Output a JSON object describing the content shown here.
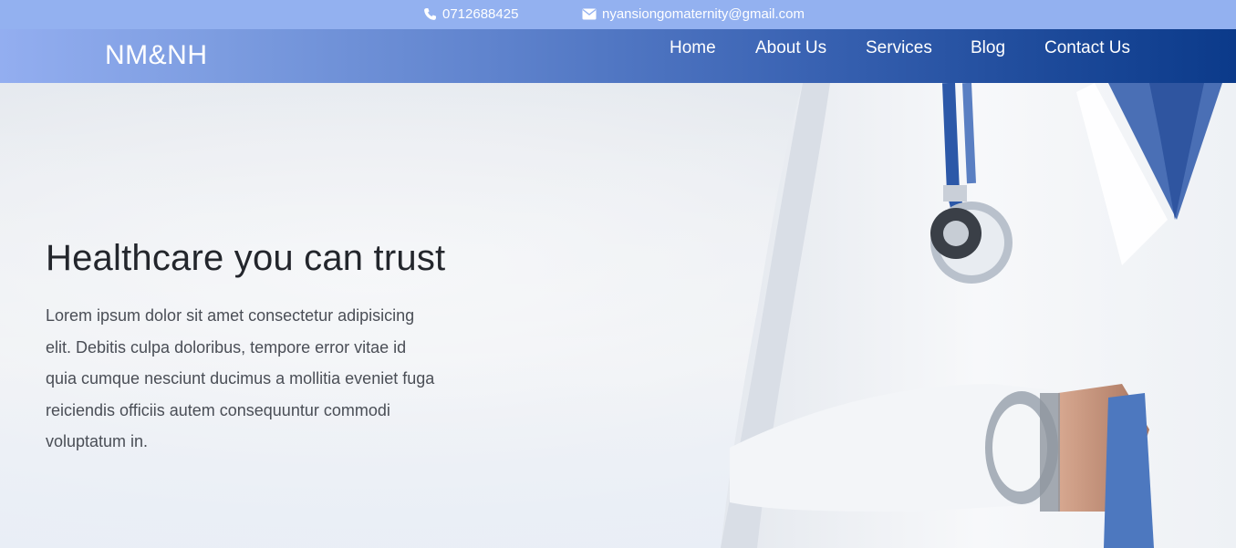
{
  "topbar": {
    "phone": "0712688425",
    "email": "nyansiongomaternity@gmail.com",
    "phone_icon": "phone-icon",
    "email_icon": "envelope-icon"
  },
  "navbar": {
    "brand": "NM&NH",
    "links": [
      {
        "label": "Home"
      },
      {
        "label": "About Us"
      },
      {
        "label": "Services"
      },
      {
        "label": "Blog"
      },
      {
        "label": "Contact Us"
      }
    ]
  },
  "hero": {
    "title": "Healthcare you can trust",
    "text": "Lorem ipsum dolor sit amet consectetur adipisicing elit. Debitis culpa doloribus, tempore error vitae id quia cumque nesciunt ducimus a mollitia eveniet fuga reiciendis officiis autem consequuntur commodi voluptatum in."
  },
  "colors": {
    "topbar": "#93b1f0",
    "nav_start": "#93aef0",
    "nav_end": "#0b3a8a",
    "title": "#23262c",
    "body_text": "#4a4e56"
  }
}
